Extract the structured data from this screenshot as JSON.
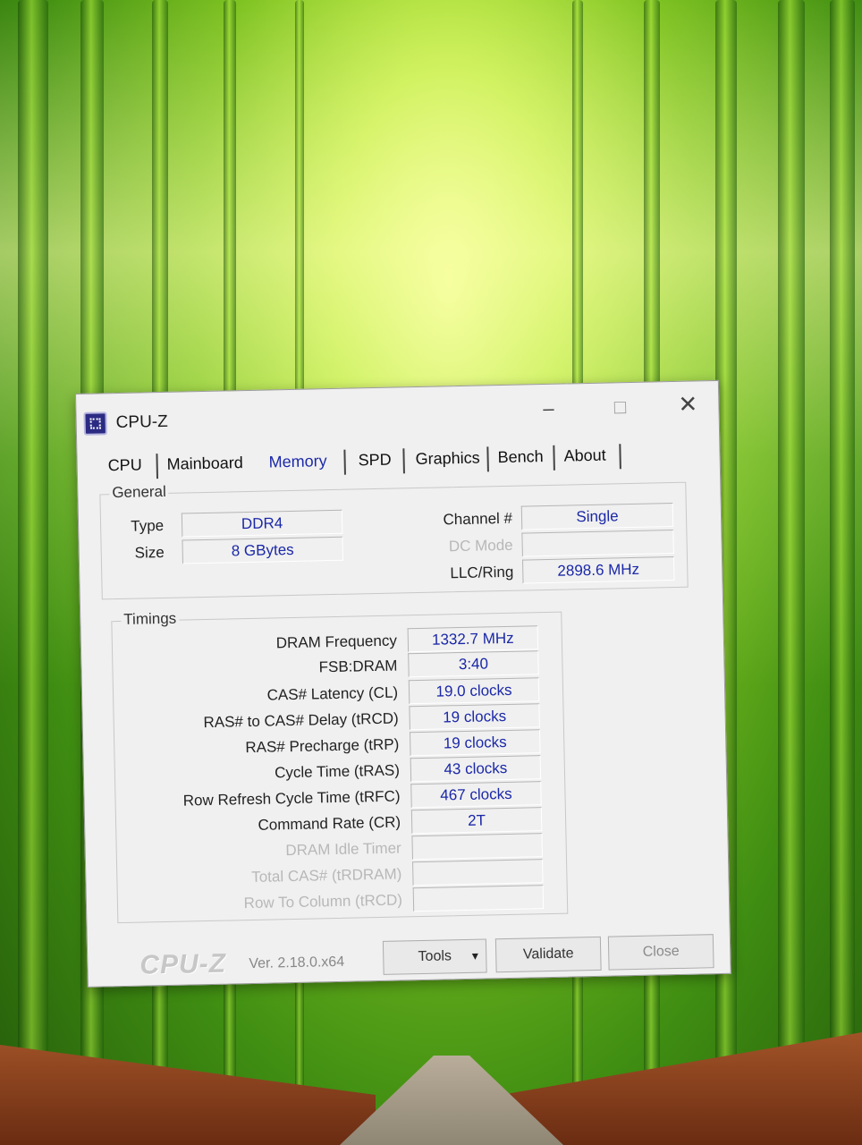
{
  "window": {
    "title": "CPU-Z",
    "icon": "cpu-z-app-icon",
    "controls": {
      "minimize": "–",
      "maximize": "□",
      "close": "✕"
    }
  },
  "tabs": [
    {
      "label": "CPU",
      "active": false
    },
    {
      "label": "Mainboard",
      "active": false
    },
    {
      "label": "Memory",
      "active": true
    },
    {
      "label": "SPD",
      "active": false
    },
    {
      "label": "Graphics",
      "active": false
    },
    {
      "label": "Bench",
      "active": false
    },
    {
      "label": "About",
      "active": false
    }
  ],
  "general": {
    "legend": "General",
    "type_label": "Type",
    "type_value": "DDR4",
    "size_label": "Size",
    "size_value": "8 GBytes",
    "channel_label": "Channel #",
    "channel_value": "Single",
    "dc_mode_label": "DC Mode",
    "dc_mode_value": "",
    "llc_label": "LLC/Ring",
    "llc_value": "2898.6 MHz"
  },
  "timings": {
    "legend": "Timings",
    "rows": [
      {
        "label": "DRAM Frequency",
        "value": "1332.7 MHz",
        "enabled": true
      },
      {
        "label": "FSB:DRAM",
        "value": "3:40",
        "enabled": true
      },
      {
        "label": "CAS# Latency (CL)",
        "value": "19.0 clocks",
        "enabled": true
      },
      {
        "label": "RAS# to CAS# Delay (tRCD)",
        "value": "19 clocks",
        "enabled": true
      },
      {
        "label": "RAS# Precharge (tRP)",
        "value": "19 clocks",
        "enabled": true
      },
      {
        "label": "Cycle Time (tRAS)",
        "value": "43 clocks",
        "enabled": true
      },
      {
        "label": "Row Refresh Cycle Time (tRFC)",
        "value": "467 clocks",
        "enabled": true
      },
      {
        "label": "Command Rate (CR)",
        "value": "2T",
        "enabled": true
      },
      {
        "label": "DRAM Idle Timer",
        "value": "",
        "enabled": false
      },
      {
        "label": "Total CAS# (tRDRAM)",
        "value": "",
        "enabled": false
      },
      {
        "label": "Row To Column (tRCD)",
        "value": "",
        "enabled": false
      }
    ]
  },
  "footer": {
    "logo": "CPU-Z",
    "version": "Ver. 2.18.0.x64",
    "tools_label": "Tools",
    "validate_label": "Validate",
    "close_label": "Close"
  },
  "colors": {
    "value_text": "#1b28a8",
    "window_bg": "#f0f0f0",
    "disabled_text": "#b8b8b8"
  }
}
